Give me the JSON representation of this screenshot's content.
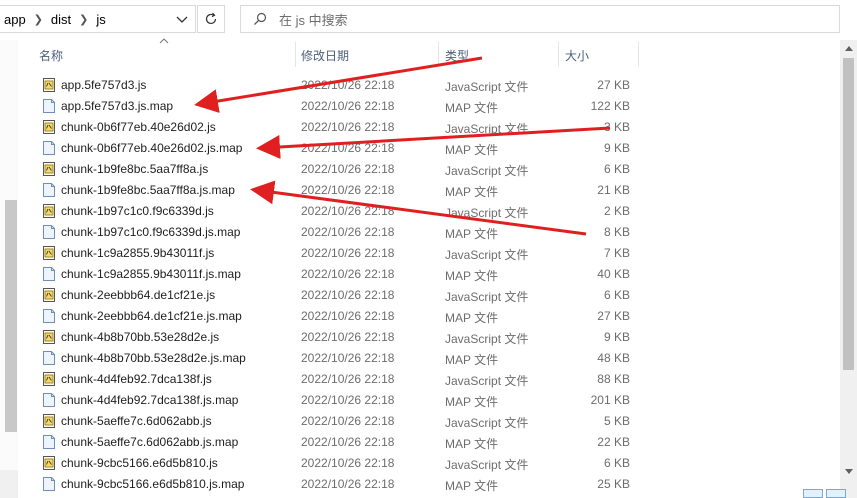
{
  "address_bar": {
    "crumbs": [
      "app",
      "dist",
      "js"
    ]
  },
  "search": {
    "placeholder": "在 js 中搜索"
  },
  "columns": {
    "name": "名称",
    "date": "修改日期",
    "type": "类型",
    "size": "大小"
  },
  "files": [
    {
      "name": "app.5fe757d3.js",
      "date": "2022/10/26 22:18",
      "type": "JavaScript 文件",
      "size": "27 KB",
      "icon": "js-file-icon"
    },
    {
      "name": "app.5fe757d3.js.map",
      "date": "2022/10/26 22:18",
      "type": "MAP 文件",
      "size": "122 KB",
      "icon": "map-file-icon"
    },
    {
      "name": "chunk-0b6f77eb.40e26d02.js",
      "date": "2022/10/26 22:18",
      "type": "JavaScript 文件",
      "size": "3 KB",
      "icon": "js-file-icon"
    },
    {
      "name": "chunk-0b6f77eb.40e26d02.js.map",
      "date": "2022/10/26 22:18",
      "type": "MAP 文件",
      "size": "9 KB",
      "icon": "map-file-icon"
    },
    {
      "name": "chunk-1b9fe8bc.5aa7ff8a.js",
      "date": "2022/10/26 22:18",
      "type": "JavaScript 文件",
      "size": "6 KB",
      "icon": "js-file-icon"
    },
    {
      "name": "chunk-1b9fe8bc.5aa7ff8a.js.map",
      "date": "2022/10/26 22:18",
      "type": "MAP 文件",
      "size": "21 KB",
      "icon": "map-file-icon"
    },
    {
      "name": "chunk-1b97c1c0.f9c6339d.js",
      "date": "2022/10/26 22:18",
      "type": "JavaScript 文件",
      "size": "2 KB",
      "icon": "js-file-icon"
    },
    {
      "name": "chunk-1b97c1c0.f9c6339d.js.map",
      "date": "2022/10/26 22:18",
      "type": "MAP 文件",
      "size": "8 KB",
      "icon": "map-file-icon"
    },
    {
      "name": "chunk-1c9a2855.9b43011f.js",
      "date": "2022/10/26 22:18",
      "type": "JavaScript 文件",
      "size": "7 KB",
      "icon": "js-file-icon"
    },
    {
      "name": "chunk-1c9a2855.9b43011f.js.map",
      "date": "2022/10/26 22:18",
      "type": "MAP 文件",
      "size": "40 KB",
      "icon": "map-file-icon"
    },
    {
      "name": "chunk-2eebbb64.de1cf21e.js",
      "date": "2022/10/26 22:18",
      "type": "JavaScript 文件",
      "size": "6 KB",
      "icon": "js-file-icon"
    },
    {
      "name": "chunk-2eebbb64.de1cf21e.js.map",
      "date": "2022/10/26 22:18",
      "type": "MAP 文件",
      "size": "27 KB",
      "icon": "map-file-icon"
    },
    {
      "name": "chunk-4b8b70bb.53e28d2e.js",
      "date": "2022/10/26 22:18",
      "type": "JavaScript 文件",
      "size": "9 KB",
      "icon": "js-file-icon"
    },
    {
      "name": "chunk-4b8b70bb.53e28d2e.js.map",
      "date": "2022/10/26 22:18",
      "type": "MAP 文件",
      "size": "48 KB",
      "icon": "map-file-icon"
    },
    {
      "name": "chunk-4d4feb92.7dca138f.js",
      "date": "2022/10/26 22:18",
      "type": "JavaScript 文件",
      "size": "88 KB",
      "icon": "js-file-icon"
    },
    {
      "name": "chunk-4d4feb92.7dca138f.js.map",
      "date": "2022/10/26 22:18",
      "type": "MAP 文件",
      "size": "201 KB",
      "icon": "map-file-icon"
    },
    {
      "name": "chunk-5aeffe7c.6d062abb.js",
      "date": "2022/10/26 22:18",
      "type": "JavaScript 文件",
      "size": "5 KB",
      "icon": "js-file-icon"
    },
    {
      "name": "chunk-5aeffe7c.6d062abb.js.map",
      "date": "2022/10/26 22:18",
      "type": "MAP 文件",
      "size": "22 KB",
      "icon": "map-file-icon"
    },
    {
      "name": "chunk-9cbc5166.e6d5b810.js",
      "date": "2022/10/26 22:18",
      "type": "JavaScript 文件",
      "size": "6 KB",
      "icon": "js-file-icon"
    },
    {
      "name": "chunk-9cbc5166.e6d5b810.js.map",
      "date": "2022/10/26 22:18",
      "type": "MAP 文件",
      "size": "25 KB",
      "icon": "map-file-icon"
    }
  ],
  "annotation": {
    "arrow_color": "#e02020"
  }
}
